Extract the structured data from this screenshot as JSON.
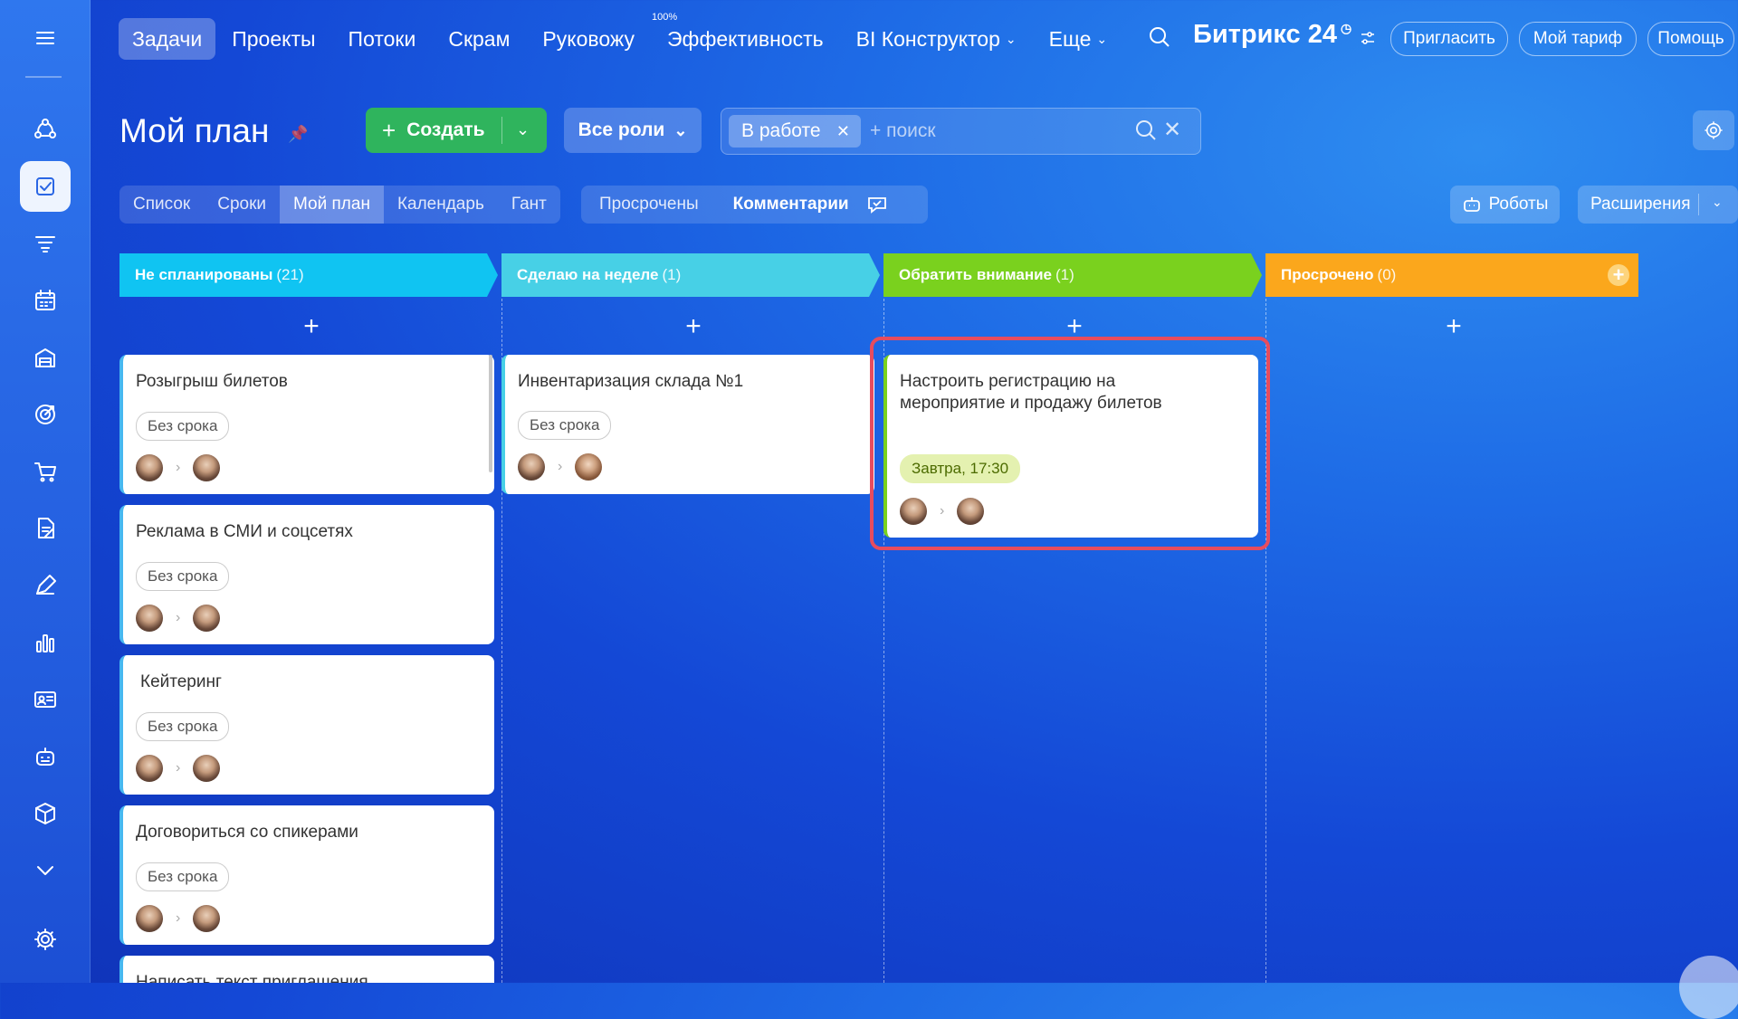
{
  "topnav": {
    "tabs": [
      {
        "label": "Задачи",
        "active": true
      },
      {
        "label": "Проекты"
      },
      {
        "label": "Потоки"
      },
      {
        "label": "Скрам"
      },
      {
        "label": "Руковожу"
      },
      {
        "label": "Эффективность",
        "sup": "100%"
      },
      {
        "label": "BI Конструктор",
        "dropdown": true
      },
      {
        "label": "Еще",
        "dropdown": true
      }
    ],
    "brand": "Битрикс 24",
    "invite": "Пригласить",
    "tariff": "Мой тариф",
    "help": "Помощь"
  },
  "page": {
    "title": "Мой план",
    "create": "Создать",
    "roles": "Все роли",
    "filter_chip": "В работе",
    "search_placeholder": "+ поиск"
  },
  "view_tabs": [
    "Список",
    "Сроки",
    "Мой план",
    "Календарь",
    "Гант"
  ],
  "filter_tabs": {
    "overdue": "Просрочены",
    "comments": "Комментарии"
  },
  "robots": "Роботы",
  "extensions": "Расширения",
  "columns": [
    {
      "title": "Не спланированы",
      "count": "(21)",
      "color": "#10c4f2"
    },
    {
      "title": "Сделаю на неделе",
      "count": "(1)",
      "color": "#47d0e6"
    },
    {
      "title": "Обратить внимание",
      "count": "(1)",
      "color": "#7ad11e"
    },
    {
      "title": "Просрочено",
      "count": "(0)",
      "color": "#fba71c"
    }
  ],
  "cards": {
    "c1": {
      "title": "Розыгрыш билетов",
      "deadline": "Без срока"
    },
    "c2": {
      "title": "Реклама в СМИ и соцсетях",
      "deadline": "Без срока"
    },
    "c3": {
      "title": "Кейтеринг",
      "deadline": "Без срока"
    },
    "c4": {
      "title": "Договориться со спикерами",
      "deadline": "Без срока"
    },
    "c5": {
      "title": "Написать текст приглашения"
    },
    "c6": {
      "title": "Инвентаризация склада №1",
      "deadline": "Без срока"
    },
    "c7": {
      "title": "Настроить регистрацию на мероприятие и продажу билетов",
      "deadline": "Завтра, 17:30"
    }
  },
  "icons": [
    "menu-icon",
    "flows-icon",
    "tasks-icon",
    "funnel-icon",
    "calendar-icon",
    "store-icon",
    "target-icon",
    "cart-icon",
    "document-icon",
    "pen-icon",
    "chart-icon",
    "contact-card-icon",
    "robot-icon",
    "box-icon",
    "chevron-down-icon",
    "settings-icon"
  ]
}
